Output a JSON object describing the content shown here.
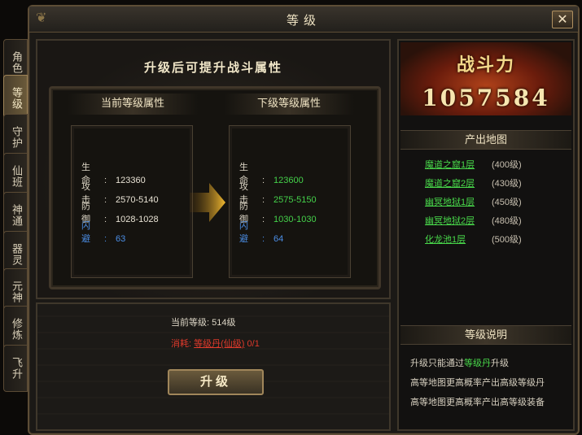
{
  "window": {
    "title": "等级",
    "close_icon": "close-icon"
  },
  "side_tabs": [
    "角色",
    "等级",
    "守护",
    "仙班",
    "神通",
    "器灵",
    "元神",
    "修炼",
    "飞升"
  ],
  "active_tab": "等级",
  "main": {
    "heading": "升级后可提升战斗属性",
    "current": {
      "header": "当前等级属性",
      "stats": [
        {
          "label": "生命:",
          "value": "123360"
        },
        {
          "label": "攻击:",
          "value": "2570-5140"
        },
        {
          "label": "防御:",
          "value": "1028-1028"
        },
        {
          "label": "闪避:",
          "value": "63"
        }
      ]
    },
    "next": {
      "header": "下级等级属性",
      "stats": [
        {
          "label": "生命:",
          "value": "123600"
        },
        {
          "label": "攻击:",
          "value": "2575-5150"
        },
        {
          "label": "防御:",
          "value": "1030-1030"
        },
        {
          "label": "闪避:",
          "value": "64"
        }
      ]
    },
    "arrow_icon": "right-arrow-icon"
  },
  "upgrade": {
    "level_label": "当前等级:",
    "level_value": "514级",
    "cost_label": "消耗:",
    "cost_item": "等级丹(仙级)",
    "cost_amount": "0/1",
    "button": "升级"
  },
  "right": {
    "power_title": "战斗力",
    "power_value": "1057584",
    "maps_header": "产出地图",
    "maps": [
      {
        "name": "魔道之窟1层",
        "level": "(400级)"
      },
      {
        "name": "魔道之窟2层",
        "level": "(430级)"
      },
      {
        "name": "幽冥地狱1层",
        "level": "(450级)"
      },
      {
        "name": "幽冥地狱2层",
        "level": "(480级)"
      },
      {
        "name": "化龙池1层",
        "level": "(500级)"
      }
    ],
    "desc_header": "等级说明",
    "desc": [
      {
        "pre": "升级只能通过",
        "hl": "等级丹",
        "post": "升级"
      },
      {
        "pre": "高等地图更高概率产出高级等级丹",
        "hl": "",
        "post": ""
      },
      {
        "pre": "高等地图更高概率产出高等级装备",
        "hl": "",
        "post": ""
      }
    ]
  },
  "colors": {
    "green": "#44d14a",
    "blue": "#4b8ee6",
    "red": "#e03a2c",
    "gold": "#f4d98a"
  }
}
